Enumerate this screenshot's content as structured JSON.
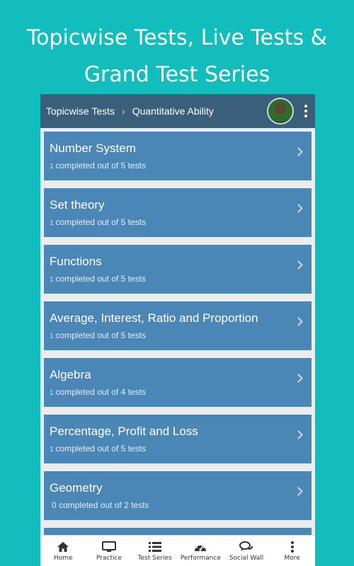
{
  "promo": {
    "line1": "Topicwise Tests, Live Tests &",
    "line2": "Grand Test Series"
  },
  "appbar": {
    "breadcrumb_root": "Topicwise Tests",
    "separator_icon": "chevron-right-icon",
    "breadcrumb_current": "Quantitative Ability",
    "menu_icon": "kebab-menu-icon"
  },
  "topics": [
    {
      "title": "Number System",
      "done": "1",
      "rest": "completed out of 5 tests"
    },
    {
      "title": "Set theory",
      "done": "1",
      "rest": "completed out of 5 tests"
    },
    {
      "title": "Functions",
      "done": "1",
      "rest": "completed out of 5 tests"
    },
    {
      "title": "Average, Interest, Ratio and Proportion",
      "done": "1",
      "rest": "completed out of 5 tests"
    },
    {
      "title": "Algebra",
      "done": "1",
      "rest": "completed out of 4 tests"
    },
    {
      "title": "Percentage, Profit and Loss",
      "done": "1",
      "rest": "completed out of 5 tests"
    },
    {
      "title": "Geometry",
      "done": "",
      "rest": "0 completed out of 2 tests"
    }
  ],
  "nav": [
    {
      "label": "Home",
      "icon": "home-icon"
    },
    {
      "label": "Practice",
      "icon": "monitor-icon"
    },
    {
      "label": "Test Series",
      "icon": "list-icon"
    },
    {
      "label": "Performance",
      "icon": "speedometer-icon"
    },
    {
      "label": "Social Wall",
      "icon": "chat-icon"
    },
    {
      "label": "More",
      "icon": "more-vertical-icon"
    }
  ],
  "colors": {
    "background": "#12bdbd",
    "appbar": "#3a5f7a",
    "card": "#4a86b6"
  }
}
